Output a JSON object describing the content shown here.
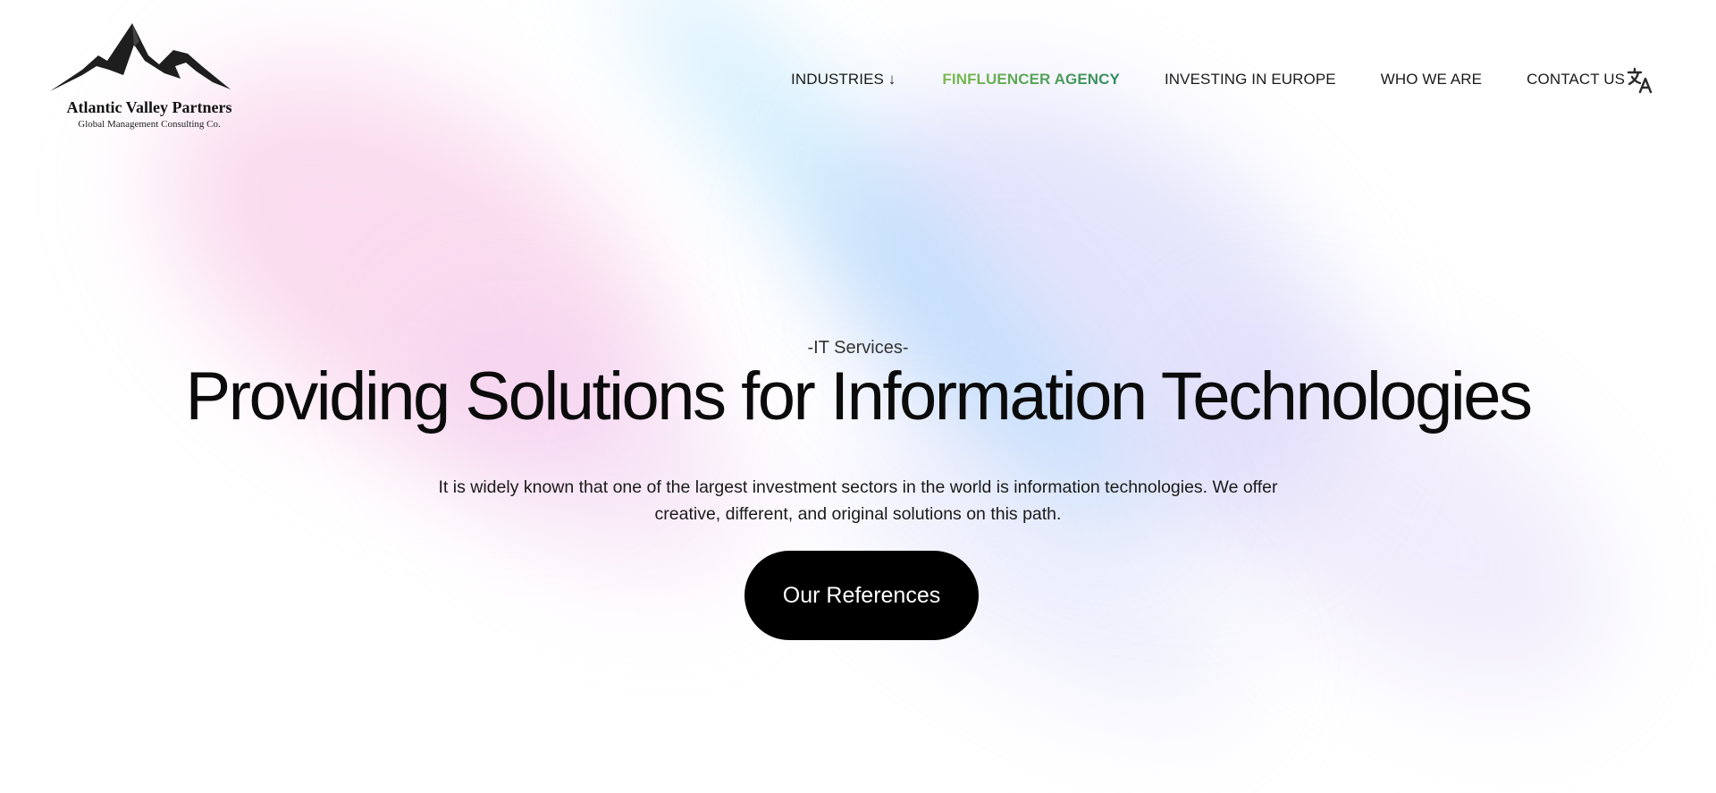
{
  "brand": {
    "name": "Atlantic Valley Partners",
    "tagline": "Global Management Consulting Co."
  },
  "nav": {
    "items": [
      {
        "label": "INDUSTRIES ↓"
      },
      {
        "label": "FINFLUENCER AGENCY",
        "accent": true
      },
      {
        "label": "INVESTING IN EUROPE"
      },
      {
        "label": "WHO WE ARE"
      },
      {
        "label": "CONTACT US"
      }
    ],
    "language_icon": "translate-icon"
  },
  "hero": {
    "eyebrow": "-IT Services-",
    "title": "Providing Solutions for Information Technologies",
    "description": "It is widely known that one of the largest investment sectors in the world is information technologies. We offer creative, different, and original solutions on this path.",
    "cta_label": "Our References"
  },
  "colors": {
    "accent_start": "#7dbd4f",
    "accent_end": "#2f8a5f",
    "cta_background": "#000000",
    "text": "#111111"
  }
}
